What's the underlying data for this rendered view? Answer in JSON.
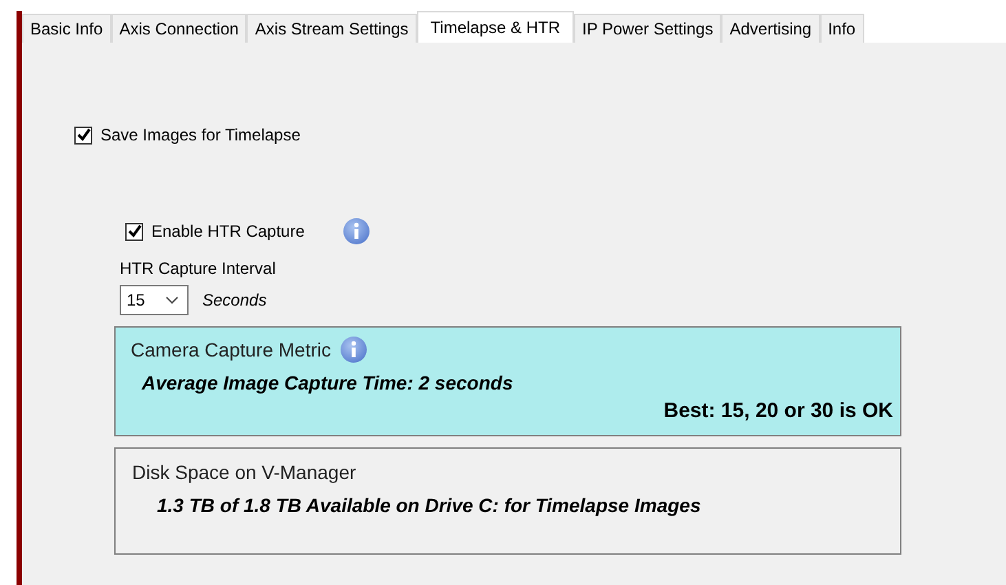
{
  "tabs": [
    {
      "label": "Basic Info",
      "selected": false
    },
    {
      "label": "Axis Connection",
      "selected": false
    },
    {
      "label": "Axis Stream Settings",
      "selected": false
    },
    {
      "label": "Timelapse & HTR",
      "selected": true
    },
    {
      "label": "IP Power Settings",
      "selected": false
    },
    {
      "label": "Advertising",
      "selected": false
    },
    {
      "label": "Info",
      "selected": false
    }
  ],
  "save_images": {
    "label": "Save Images for Timelapse",
    "checked": true
  },
  "htr": {
    "label": "Enable HTR Capture",
    "checked": true
  },
  "interval": {
    "label": "HTR Capture Interval",
    "value": "15",
    "unit": "Seconds"
  },
  "capture_metric": {
    "title": "Camera Capture Metric",
    "average": "Average Image Capture Time: 2 seconds",
    "advice": "Best: 15, 20 or 30 is OK"
  },
  "disk_space": {
    "title": "Disk Space on V-Manager",
    "summary": "1.3 TB of 1.8 TB Available on Drive C: for Timelapse Images"
  }
}
